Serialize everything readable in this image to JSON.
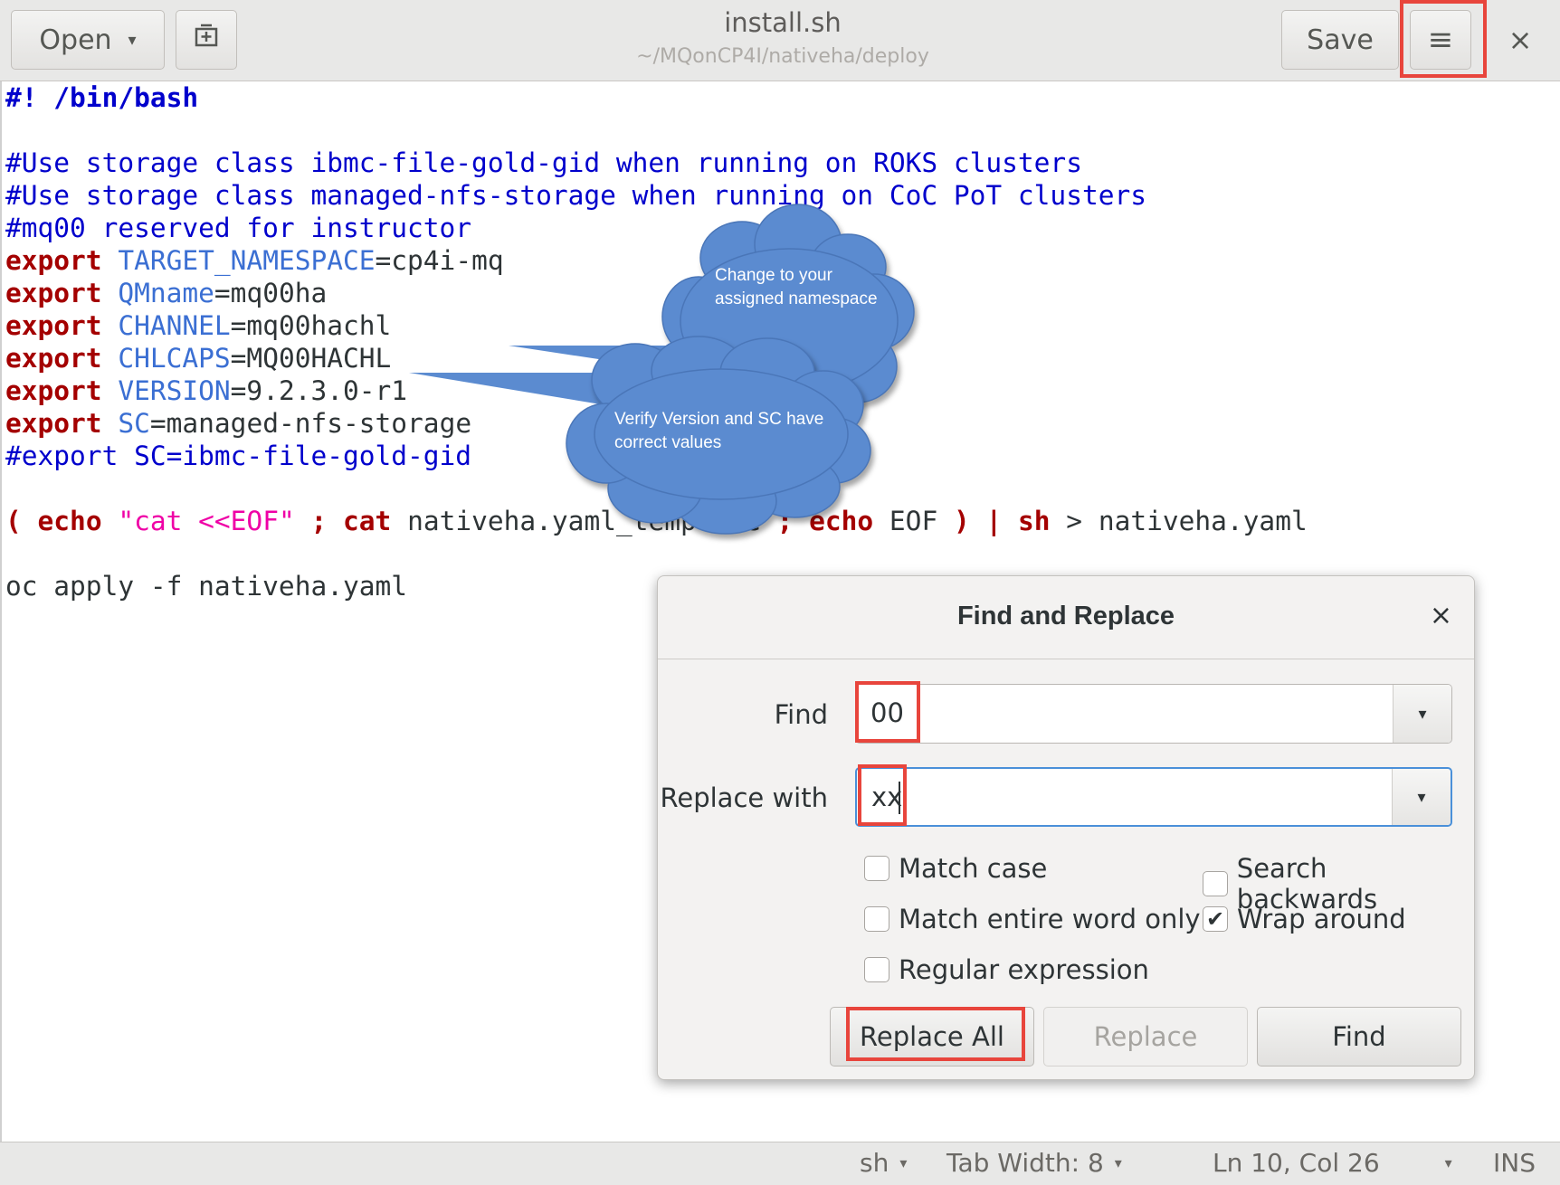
{
  "header": {
    "open_label": "Open",
    "title": "install.sh",
    "subtitle": "~/MQonCP4I/nativeha/deploy",
    "save_label": "Save",
    "close_glyph": "×",
    "menu_glyph": "≡",
    "dropdown_glyph": "▾"
  },
  "editor": {
    "line1": "#! /bin/bash",
    "line3": "#Use storage class ibmc-file-gold-gid when running on ROKS clusters",
    "line4": "#Use storage class managed-nfs-storage when running on CoC PoT clusters",
    "line5": "#mq00 reserved for instructor",
    "exports": [
      {
        "kw": "export",
        "name": "TARGET_NAMESPACE",
        "value": "=cp4i-mq"
      },
      {
        "kw": "export",
        "name": "QMname",
        "value": "=mq00ha"
      },
      {
        "kw": "export",
        "name": "CHANNEL",
        "value": "=mq00hachl"
      },
      {
        "kw": "export",
        "name": "CHLCAPS",
        "value": "=MQ00HACHL"
      },
      {
        "kw": "export",
        "name": "VERSION",
        "value": "=9.2.3.0-r1"
      },
      {
        "kw": "export",
        "name": "SC",
        "value": "=managed-nfs-storage"
      }
    ],
    "line12": "#export SC=ibmc-file-gold-gid",
    "pipe_line": {
      "p1": "( ",
      "echo1": "echo",
      "sp1": " ",
      "str": "\"cat <<EOF\"",
      "semi1": " ; ",
      "cat": "cat",
      "mid": " nativeha.yaml_template ",
      "semi2": "; ",
      "echo2": "echo",
      "eof": " EOF ",
      "close": ") | ",
      "sh": "sh",
      "tail": " > nativeha.yaml"
    },
    "line16": "oc apply -f nativeha.yaml"
  },
  "callouts": {
    "namespace_line1": "Change to your",
    "namespace_line2": "assigned namespace",
    "version_line1": "Verify Version and SC have",
    "version_line2": "correct values",
    "color": "#5b8bd0"
  },
  "dialog": {
    "title": "Find and Replace",
    "close_glyph": "×",
    "find_label": "Find",
    "find_value": "00",
    "replace_label": "Replace with",
    "replace_value": "xx",
    "options": {
      "match_case": {
        "label": "Match case",
        "checked": false
      },
      "search_backwards": {
        "label": "Search backwards",
        "checked": false
      },
      "match_word": {
        "label": "Match entire word only",
        "checked": false
      },
      "wrap_around": {
        "label": "Wrap around",
        "checked": true
      },
      "regex": {
        "label": "Regular expression",
        "checked": false
      }
    },
    "check_glyph": "✔",
    "buttons": {
      "replace_all": "Replace All",
      "replace": "Replace",
      "find": "Find"
    }
  },
  "statusbar": {
    "language": "sh",
    "tab_width": "Tab Width: 8",
    "position": "Ln 10, Col 26",
    "mode": "INS"
  },
  "colors": {
    "highlight_border": "#e8453c",
    "keyword": "#a40000",
    "comment": "#0000cc",
    "string": "#ef00a6",
    "focus": "#4a90d9"
  }
}
